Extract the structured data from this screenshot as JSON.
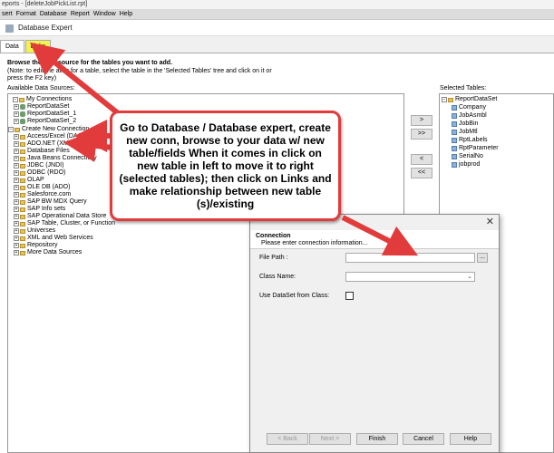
{
  "window": {
    "title": "eports - [deleteJobPickList.rpt]"
  },
  "menu": [
    "sert",
    "Format",
    "Database",
    "Report",
    "Window",
    "Help"
  ],
  "dialog": {
    "title": "Database Expert"
  },
  "tabs": [
    "Data",
    "Links"
  ],
  "instructions": {
    "line1": "Browse the data source for the tables you want to add.",
    "line2": "(Note: to edit the alias for a table, select the table in the 'Selected Tables' tree and click on it or",
    "line3": "press the F2 key)"
  },
  "available_label": "Available Data Sources:",
  "selected_label": "Selected Tables:",
  "available_tree": [
    "My Connections",
    "ReportDataSet",
    "ReportDataSet_1",
    "ReportDataSet_2",
    "Create New Connection",
    "Access/Excel (DAO)",
    "ADO.NET (XML)",
    "Database Files",
    "Java Beans Connectivity",
    "JDBC (JNDI)",
    "ODBC (RDO)",
    "OLAP",
    "OLE DB (ADO)",
    "Salesforce.com",
    "SAP BW MDX Query",
    "SAP Info sets",
    "SAP Operational Data Store",
    "SAP Table, Cluster, or Function",
    "Universes",
    "XML and Web Services",
    "Repository",
    "More Data Sources"
  ],
  "selected_tree": {
    "root": "ReportDataSet",
    "tables": [
      "Company",
      "JobAsmbl",
      "JobBin",
      "JobMtl",
      "RptLabels",
      "RptParameter",
      "SerialNo",
      "jobprod"
    ]
  },
  "move_buttons": [
    ">",
    ">>",
    "<",
    "<<"
  ],
  "connection": {
    "heading": "Connection",
    "subheading": "Please enter connection information...",
    "file_path_label": "File Path :",
    "file_path_value": "",
    "browse_label": "...",
    "class_name_label": "Class Name:",
    "class_name_value": "",
    "use_dataset_label": "Use DataSet from Class:",
    "close_label": "✕",
    "buttons": {
      "back": "< Back",
      "next": "Next >",
      "finish": "Finish",
      "cancel": "Cancel",
      "help": "Help"
    }
  },
  "callout": {
    "text": "Go to Database / Database expert, create new conn, browse to your data w/ new table/fields When it comes in click on new table in left to move it to right (selected tables); then click on Links and make relationship between new table (s)/existing",
    "color": "#e23b3b"
  }
}
